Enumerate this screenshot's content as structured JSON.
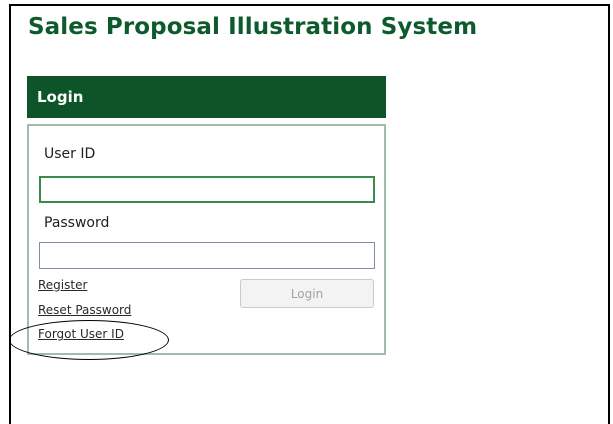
{
  "app": {
    "title": "Sales Proposal Illustration System"
  },
  "login": {
    "header": "Login",
    "user_id_label": "User ID",
    "user_id_value": "",
    "password_label": "Password",
    "password_value": "",
    "button_label": "Login",
    "links": {
      "register": "Register",
      "reset_password": "Reset Password",
      "forgot_user_id": "Forgot User ID"
    }
  },
  "colors": {
    "brand_green": "#0d5528",
    "title_green": "#0d5a2c",
    "panel_border": "#9fbea9"
  }
}
